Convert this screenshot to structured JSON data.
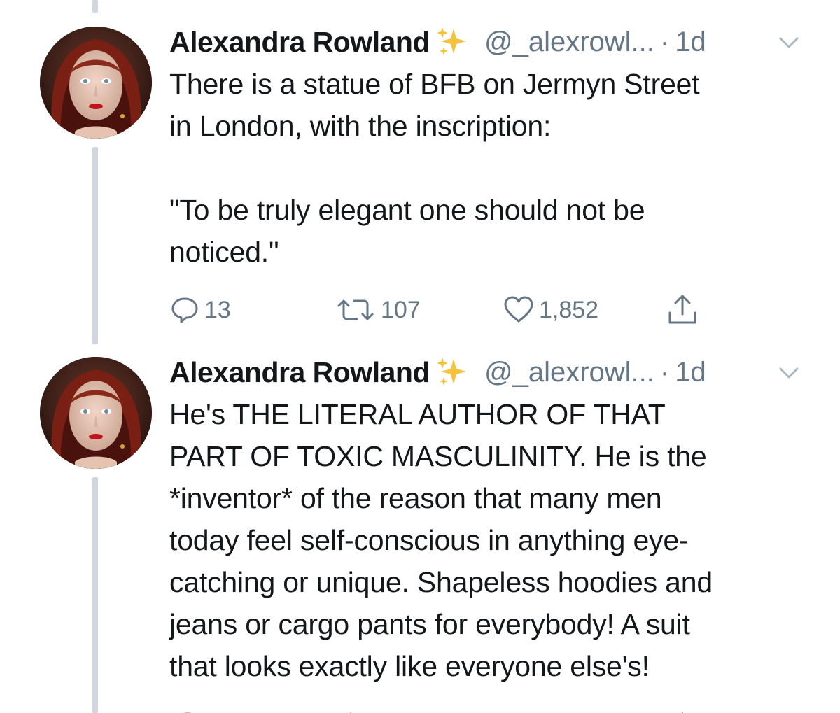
{
  "thread": {
    "tweets": [
      {
        "name": "Alexandra Rowland",
        "sparkle_icon": "sparkles-emoji-icon",
        "handle": "@_alexrowl...",
        "separator": "·",
        "time": "1d",
        "text": "There is a statue of BFB on Jermyn Street\nin London, with the inscription:\n\n\"To be truly elegant one should not be\nnoticed.\"",
        "actions": {
          "replies": "13",
          "retweets": "107",
          "likes": "1,852"
        }
      },
      {
        "name": "Alexandra Rowland",
        "sparkle_icon": "sparkles-emoji-icon",
        "handle": "@_alexrowl...",
        "separator": "·",
        "time": "1d",
        "text": "He's THE LITERAL AUTHOR OF THAT\nPART OF TOXIC MASCULINITY. He is the\n*inventor* of the reason that many men\ntoday feel self-conscious in anything eye-\ncatching or unique. Shapeless hoodies and\njeans or cargo pants for everybody! A suit\nthat looks exactly like everyone else's!"
      }
    ]
  },
  "colors": {
    "text": "#14171a",
    "secondary": "#657786",
    "thread_line": "#cfd6dd",
    "sparkle": "#f5c23d"
  }
}
